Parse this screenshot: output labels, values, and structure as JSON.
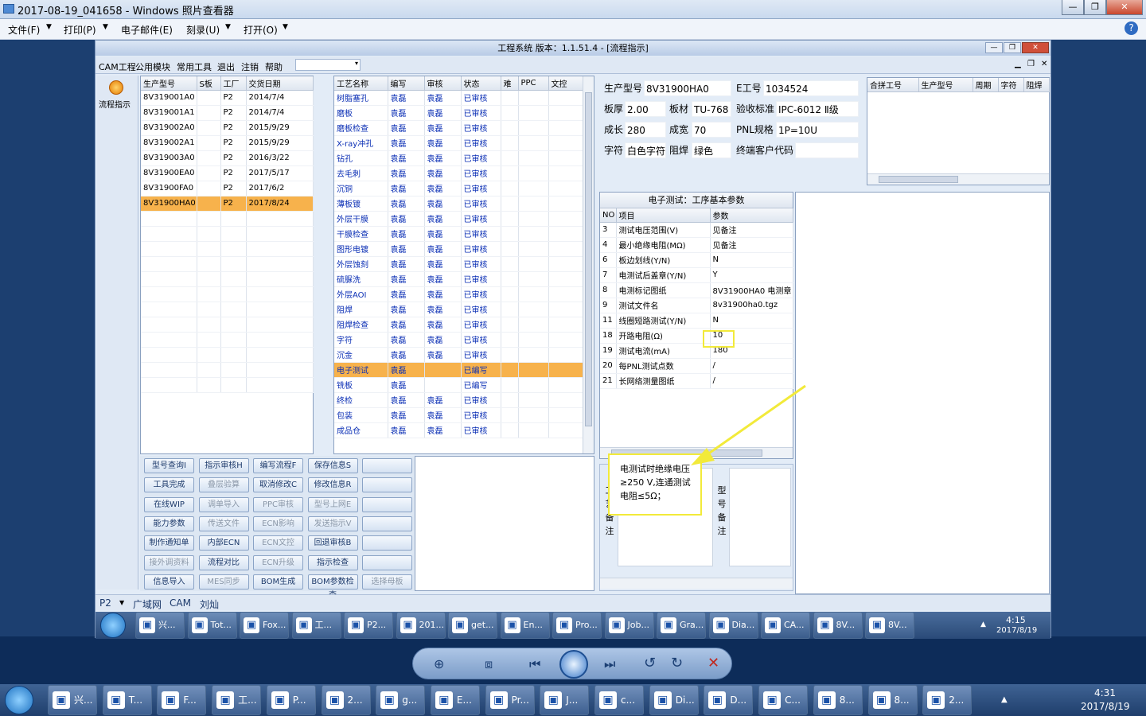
{
  "viewer": {
    "title": "2017-08-19_041658 - Windows 照片查看器",
    "menu": [
      "文件(F)",
      "打印(P)",
      "电子邮件(E)",
      "刻录(U)",
      "打开(O)"
    ],
    "help": "?"
  },
  "app": {
    "title": "工程系统   版本：1.1.51.4 - [流程指示]",
    "menu": [
      "CAM工程",
      "公用模块",
      "常用工具",
      "退出",
      "注销",
      "帮助"
    ],
    "left_tool": "流程指示"
  },
  "model_table": {
    "headers": [
      "生产型号",
      "S板",
      "工厂",
      "交货日期"
    ],
    "rows": [
      [
        "8V319001A0",
        "",
        "P2",
        "2014/7/4"
      ],
      [
        "8V319001A1",
        "",
        "P2",
        "2014/7/4"
      ],
      [
        "8V319002A0",
        "",
        "P2",
        "2015/9/29"
      ],
      [
        "8V319002A1",
        "",
        "P2",
        "2015/9/29"
      ],
      [
        "8V319003A0",
        "",
        "P2",
        "2016/3/22"
      ],
      [
        "8V31900EA0",
        "",
        "P2",
        "2017/5/17"
      ],
      [
        "8V31900FA0",
        "",
        "P2",
        "2017/6/2"
      ],
      [
        "8V31900HA0",
        "",
        "P2",
        "2017/8/24"
      ]
    ]
  },
  "process_table": {
    "headers": [
      "工艺名称",
      "编写",
      "审核",
      "状态",
      "难",
      "PPC",
      "文控"
    ],
    "rows": [
      [
        "树脂塞孔",
        "袁磊",
        "袁磊",
        "已审核"
      ],
      [
        "磨板",
        "袁磊",
        "袁磊",
        "已审核"
      ],
      [
        "磨板检查",
        "袁磊",
        "袁磊",
        "已审核"
      ],
      [
        "X-ray冲孔",
        "袁磊",
        "袁磊",
        "已审核"
      ],
      [
        "钻孔",
        "袁磊",
        "袁磊",
        "已审核"
      ],
      [
        "去毛刺",
        "袁磊",
        "袁磊",
        "已审核"
      ],
      [
        "沉铜",
        "袁磊",
        "袁磊",
        "已审核"
      ],
      [
        "薄板镀",
        "袁磊",
        "袁磊",
        "已审核"
      ],
      [
        "外层干膜",
        "袁磊",
        "袁磊",
        "已审核"
      ],
      [
        "干膜检查",
        "袁磊",
        "袁磊",
        "已审核"
      ],
      [
        "图形电镀",
        "袁磊",
        "袁磊",
        "已审核"
      ],
      [
        "外层蚀刻",
        "袁磊",
        "袁磊",
        "已审核"
      ],
      [
        "硫脲洗",
        "袁磊",
        "袁磊",
        "已审核"
      ],
      [
        "外层AOI",
        "袁磊",
        "袁磊",
        "已审核"
      ],
      [
        "阻焊",
        "袁磊",
        "袁磊",
        "已审核"
      ],
      [
        "阻焊检查",
        "袁磊",
        "袁磊",
        "已审核"
      ],
      [
        "字符",
        "袁磊",
        "袁磊",
        "已审核"
      ],
      [
        "沉金",
        "袁磊",
        "袁磊",
        "已审核"
      ],
      [
        "电子测试",
        "袁磊",
        "",
        "已编写"
      ],
      [
        "铣板",
        "袁磊",
        "",
        "已编写"
      ],
      [
        "终检",
        "袁磊",
        "袁磊",
        "已审核"
      ],
      [
        "包装",
        "袁磊",
        "袁磊",
        "已审核"
      ],
      [
        "成品仓",
        "袁磊",
        "袁磊",
        "已审核"
      ]
    ]
  },
  "buttons": [
    [
      "型号查询I",
      "指示审核H",
      "编写流程F",
      "保存信息S",
      ""
    ],
    [
      "工具完成",
      "叠层验算",
      "取消修改C",
      "修改信息R",
      ""
    ],
    [
      "在线WIP",
      "调单导入",
      "PPC审核",
      "型号上网E",
      ""
    ],
    [
      "能力参数",
      "传送文件",
      "ECN影响",
      "发送指示V",
      ""
    ],
    [
      "制作通知单",
      "内部ECN",
      "ECN文控",
      "回退审核B",
      ""
    ],
    [
      "接外调资料",
      "流程对比",
      "ECN升级",
      "指示检查",
      ""
    ],
    [
      "信息导入",
      "MES同步",
      "BOM生成",
      "BOM参数检查",
      "选择母板"
    ]
  ],
  "info": {
    "labels": [
      "生产型号",
      "E工号",
      "板厚",
      "板材",
      "验收标准",
      "成长",
      "成宽",
      "PNL规格",
      "字符",
      "阻焊",
      "终端客户代码"
    ],
    "values": [
      "8V31900HA0",
      "1034524",
      "2.00",
      "TU-768",
      "IPC-6012 Ⅱ级",
      "280",
      "70",
      "1P=10U",
      "白色字符",
      "绿色",
      ""
    ]
  },
  "merge_table": {
    "headers": [
      "合拼工号",
      "生产型号",
      "周期",
      "字符",
      "阻焊"
    ]
  },
  "params": {
    "title": "电子测试：工序基本参数",
    "headers": [
      "NO",
      "项目",
      "参数"
    ],
    "rows": [
      [
        "3",
        "测试电压范围(V)",
        "见备注"
      ],
      [
        "4",
        "最小绝缘电阻(MΩ)",
        "见备注"
      ],
      [
        "6",
        "板边划线(Y/N)",
        "N"
      ],
      [
        "7",
        "电测试后盖章(Y/N)",
        "Y"
      ],
      [
        "8",
        "电测标记图纸",
        "8V31900HA0 电测章"
      ],
      [
        "9",
        "测试文件名",
        "8v31900ha0.tgz"
      ],
      [
        "11",
        "线圈短路测试(Y/N)",
        "N"
      ],
      [
        "18",
        "开路电阻(Ω)",
        "10"
      ],
      [
        "19",
        "测试电流(mA)",
        "180"
      ],
      [
        "20",
        "每PNL测试点数",
        "/"
      ],
      [
        "21",
        "长网络测量图纸",
        "/"
      ]
    ]
  },
  "remarks": {
    "craft_label": "工艺备注",
    "model_label": "型号备注",
    "text": "电测试时绝缘电压≥250 V,连通测试电阻≤5Ω；"
  },
  "status": {
    "plant": "P2",
    "items": [
      "广域网",
      "CAM",
      "刘灿"
    ]
  },
  "inner_taskbar": {
    "items": [
      "兴...",
      "Tot...",
      "Fox...",
      "工...",
      "P2...",
      "201...",
      "get...",
      "En...",
      "Pro...",
      "Job...",
      "Gra...",
      "Dia...",
      "CA...",
      "8V...",
      "8V..."
    ],
    "time": "4:15",
    "date": "2017/8/19"
  },
  "taskbar": {
    "items": [
      "兴...",
      "T...",
      "F...",
      "工...",
      "P...",
      "2...",
      "g...",
      "E...",
      "Pr...",
      "J...",
      "c...",
      "Di...",
      "D...",
      "C...",
      "8...",
      "8...",
      "2..."
    ],
    "time": "4:31",
    "date": "2017/8/19"
  },
  "colors": {
    "accent": "#f7b24c",
    "link": "#0b2fb5",
    "annotation": "#f2ea3a"
  }
}
